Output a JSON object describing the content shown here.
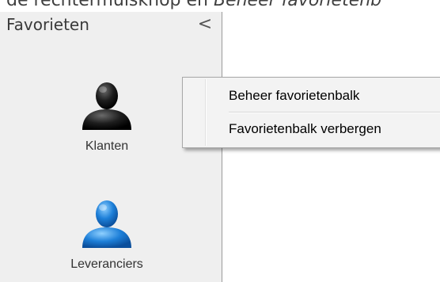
{
  "caption": {
    "prefix": "de rechtermuisknop en ",
    "emphasis": "Beheer favorietenb"
  },
  "sidebar": {
    "title": "Favorieten",
    "collapse_glyph": "<",
    "items": [
      {
        "label": "Klanten",
        "icon": "person-black-icon",
        "color": "#1a1a1a"
      },
      {
        "label": "Leveranciers",
        "icon": "person-blue-icon",
        "color": "#1d7fd8"
      }
    ]
  },
  "context_menu": {
    "items": [
      {
        "label": "Beheer favorietenbalk"
      },
      {
        "label": "Favorietenbalk verbergen"
      }
    ]
  }
}
